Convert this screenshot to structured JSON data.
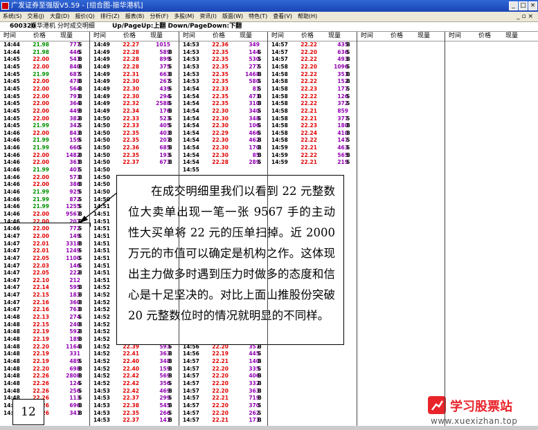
{
  "window": {
    "title": "广发证券至强版V5.59 - [组合图-振华港机]",
    "min": "_",
    "max": "□",
    "close": "×"
  },
  "menu": {
    "items": [
      "系统(S)",
      "交易(J)",
      "大盘(D)",
      "报价(Q)",
      "排行(Z)",
      "报表(B)",
      "分析(F)",
      "多股(M)",
      "资讯(I)",
      "版面(W)",
      "特色(T)",
      "查看(V)",
      "帮助(H)"
    ],
    "right": "_ ▫ ×"
  },
  "info": {
    "code": "600320",
    "name": "振华港机 分时成交明细",
    "hint": "Up/PageUp:上翻 Down/PageDown:下翻"
  },
  "headers": [
    "时间",
    "价格",
    "现量"
  ],
  "trades": {
    "col1": [
      [
        "14:44",
        "21.98",
        "777",
        "S"
      ],
      [
        "14:44",
        "21.98",
        "446",
        "S"
      ],
      [
        "14:45",
        "22.00",
        "541",
        "B"
      ],
      [
        "14:45",
        "22.00",
        "840",
        "B"
      ],
      [
        "14:45",
        "21.99",
        "687",
        "S"
      ],
      [
        "14:45",
        "22.00",
        "478",
        "B"
      ],
      [
        "14:45",
        "22.00",
        "564",
        "B"
      ],
      [
        "14:45",
        "22.00",
        "791",
        "B"
      ],
      [
        "14:45",
        "22.00",
        "364",
        "B"
      ],
      [
        "14:45",
        "22.00",
        "449",
        "B"
      ],
      [
        "14:45",
        "22.00",
        "382",
        "B"
      ],
      [
        "14:45",
        "21.99",
        "342",
        "S"
      ],
      [
        "14:46",
        "22.00",
        "843",
        "B"
      ],
      [
        "14:46",
        "21.99",
        "159",
        "S"
      ],
      [
        "14:46",
        "21.99",
        "660",
        "S"
      ],
      [
        "14:46",
        "22.00",
        "1482",
        "B"
      ],
      [
        "14:46",
        "22.00",
        "361",
        "B"
      ],
      [
        "14:46",
        "21.99",
        "401",
        "S"
      ],
      [
        "14:46",
        "22.00",
        "573",
        "B"
      ],
      [
        "14:46",
        "22.00",
        "386",
        "B"
      ],
      [
        "14:46",
        "21.99",
        "925",
        "S"
      ],
      [
        "14:46",
        "21.99",
        "872",
        "S"
      ],
      [
        "14:46",
        "21.99",
        "1255",
        "S"
      ],
      [
        "14:46",
        "22.00",
        "9567",
        "B"
      ],
      [
        "14:46",
        "22.00",
        "207",
        "B"
      ],
      [
        "14:46",
        "22.00",
        "772",
        "S"
      ],
      [
        "14:47",
        "22.00",
        "149",
        "S"
      ],
      [
        "14:47",
        "22.01",
        "3318",
        "B"
      ],
      [
        "14:47",
        "22.01",
        "1249",
        "S"
      ],
      [
        "14:47",
        "22.05",
        "1100",
        "S"
      ],
      [
        "14:47",
        "22.03",
        "146",
        "S"
      ],
      [
        "14:47",
        "22.05",
        "222",
        "B"
      ],
      [
        "14:47",
        "22.10",
        "212",
        ""
      ],
      [
        "14:47",
        "22.14",
        "595",
        "B"
      ],
      [
        "14:47",
        "22.15",
        "183",
        "B"
      ],
      [
        "14:47",
        "22.16",
        "360",
        "B"
      ],
      [
        "14:47",
        "22.16",
        "763",
        "B"
      ],
      [
        "14:48",
        "22.13",
        "274",
        "S"
      ],
      [
        "14:48",
        "22.15",
        "240",
        "B"
      ],
      [
        "14:48",
        "22.19",
        "592",
        "B"
      ],
      [
        "14:48",
        "22.19",
        "189",
        "B"
      ],
      [
        "14:48",
        "22.20",
        "1164",
        "B"
      ],
      [
        "14:48",
        "22.19",
        "331",
        ""
      ],
      [
        "14:48",
        "22.19",
        "489",
        "S"
      ],
      [
        "14:48",
        "22.20",
        "698",
        "B"
      ],
      [
        "14:48",
        "22.26",
        "2808",
        "B"
      ],
      [
        "14:48",
        "22.26",
        "124",
        "S"
      ],
      [
        "14:48",
        "22.26",
        "256",
        "S"
      ],
      [
        "14:48",
        "22.26",
        "113",
        "S"
      ],
      [
        "14:48",
        "22.26",
        "696",
        "B"
      ],
      [
        "14:48",
        "22.26",
        "341",
        "B"
      ]
    ],
    "col2": [
      [
        "14:49",
        "22.27",
        "1015",
        ""
      ],
      [
        "14:49",
        "22.28",
        "589",
        "B"
      ],
      [
        "14:49",
        "22.28",
        "899",
        "S"
      ],
      [
        "14:49",
        "22.28",
        "375",
        "S"
      ],
      [
        "14:49",
        "22.31",
        "663",
        "B"
      ],
      [
        "14:49",
        "22.30",
        "267",
        "S"
      ],
      [
        "14:49",
        "22.30",
        "439",
        "S"
      ],
      [
        "14:49",
        "22.30",
        "294",
        "S"
      ],
      [
        "14:49",
        "22.32",
        "2588",
        "S"
      ],
      [
        "14:49",
        "22.34",
        "176",
        "B"
      ],
      [
        "14:50",
        "22.33",
        "523",
        "S"
      ],
      [
        "14:50",
        "22.33",
        "405",
        "S"
      ],
      [
        "14:50",
        "22.35",
        "403",
        "B"
      ],
      [
        "14:50",
        "22.35",
        "207",
        "B"
      ],
      [
        "14:50",
        "22.36",
        "685",
        "B"
      ],
      [
        "14:50",
        "22.35",
        "193",
        "S"
      ],
      [
        "14:50",
        "22.37",
        "673",
        "B"
      ],
      [
        "14:50",
        "",
        "",
        ""
      ],
      [
        "14:50",
        "",
        "",
        ""
      ],
      [
        "14:50",
        "",
        "",
        ""
      ],
      [
        "14:50",
        "",
        "",
        ""
      ],
      [
        "14:50",
        "",
        "",
        ""
      ],
      [
        "14:51",
        "",
        "",
        ""
      ],
      [
        "14:51",
        "",
        "",
        ""
      ],
      [
        "14:51",
        "",
        "",
        ""
      ],
      [
        "14:51",
        "",
        "",
        ""
      ],
      [
        "14:51",
        "",
        "",
        ""
      ],
      [
        "14:51",
        "",
        "",
        ""
      ],
      [
        "14:51",
        "",
        "",
        ""
      ],
      [
        "14:51",
        "",
        "",
        ""
      ],
      [
        "14:51",
        "",
        "",
        ""
      ],
      [
        "14:51",
        "",
        "",
        ""
      ],
      [
        "14:51",
        "",
        "",
        ""
      ],
      [
        "14:52",
        "",
        "",
        ""
      ],
      [
        "14:52",
        "",
        "",
        ""
      ],
      [
        "14:52",
        "",
        "",
        ""
      ],
      [
        "14:52",
        "",
        "",
        ""
      ],
      [
        "14:52",
        "",
        "",
        ""
      ],
      [
        "14:52",
        "",
        "",
        ""
      ],
      [
        "14:52",
        "",
        "",
        ""
      ],
      [
        "14:52",
        "",
        "",
        ""
      ],
      [
        "14:52",
        "22.39",
        "593",
        "S"
      ],
      [
        "14:52",
        "22.41",
        "363",
        "B"
      ],
      [
        "14:52",
        "22.40",
        "348",
        "B"
      ],
      [
        "14:52",
        "22.40",
        "159",
        "B"
      ],
      [
        "14:52",
        "22.42",
        "569",
        "B"
      ],
      [
        "14:52",
        "22.42",
        "356",
        "S"
      ],
      [
        "14:53",
        "22.42",
        "469",
        "B"
      ],
      [
        "14:53",
        "22.37",
        "299",
        "S"
      ],
      [
        "14:53",
        "22.38",
        "545",
        "B"
      ],
      [
        "14:53",
        "22.35",
        "266",
        "S"
      ],
      [
        "14:53",
        "22.37",
        "141",
        "B"
      ]
    ],
    "col3": [
      [
        "14:53",
        "22.36",
        "349",
        ""
      ],
      [
        "14:53",
        "22.35",
        "144",
        "S"
      ],
      [
        "14:53",
        "22.35",
        "530",
        "S"
      ],
      [
        "14:53",
        "22.35",
        "277",
        "S"
      ],
      [
        "14:53",
        "22.35",
        "1468",
        "B"
      ],
      [
        "14:53",
        "22.35",
        "580",
        "S"
      ],
      [
        "14:54",
        "22.33",
        "81",
        "S"
      ],
      [
        "14:54",
        "22.35",
        "471",
        "B"
      ],
      [
        "14:54",
        "22.35",
        "310",
        "B"
      ],
      [
        "14:54",
        "22.30",
        "340",
        "S"
      ],
      [
        "14:54",
        "22.30",
        "348",
        "S"
      ],
      [
        "14:54",
        "22.30",
        "106",
        "S"
      ],
      [
        "14:54",
        "22.29",
        "466",
        "S"
      ],
      [
        "14:54",
        "22.30",
        "462",
        "B"
      ],
      [
        "14:54",
        "22.30",
        "170",
        "B"
      ],
      [
        "14:54",
        "22.30",
        "85",
        "B"
      ],
      [
        "14:54",
        "22.28",
        "289",
        "S"
      ],
      [
        "14:55",
        "",
        "",
        ""
      ],
      [
        "14:55",
        "",
        "",
        ""
      ],
      [
        "14:55",
        "",
        "",
        ""
      ],
      [
        "14:55",
        "",
        "",
        ""
      ],
      [
        "14:55",
        "",
        "",
        ""
      ],
      [
        "14:55",
        "",
        "",
        ""
      ],
      [
        "14:55",
        "",
        "",
        ""
      ],
      [
        "14:55",
        "",
        "",
        ""
      ],
      [
        "14:55",
        "",
        "",
        ""
      ],
      [
        "14:55",
        "",
        "",
        ""
      ],
      [
        "14:56",
        "",
        "",
        ""
      ],
      [
        "14:56",
        "",
        "",
        ""
      ],
      [
        "14:56",
        "",
        "",
        ""
      ],
      [
        "14:56",
        "",
        "",
        ""
      ],
      [
        "14:56",
        "",
        "",
        ""
      ],
      [
        "14:56",
        "",
        "",
        ""
      ],
      [
        "14:56",
        "",
        "",
        ""
      ],
      [
        "14:56",
        "",
        "",
        ""
      ],
      [
        "14:56",
        "",
        "",
        ""
      ],
      [
        "14:56",
        "",
        "",
        ""
      ],
      [
        "14:56",
        "",
        "",
        ""
      ],
      [
        "14:56",
        "",
        "",
        ""
      ],
      [
        "14:56",
        "",
        "",
        ""
      ],
      [
        "14:56",
        "",
        "",
        ""
      ],
      [
        "14:56",
        "22.20",
        "357",
        "B"
      ],
      [
        "14:56",
        "22.19",
        "445",
        "S"
      ],
      [
        "14:57",
        "22.21",
        "140",
        "B"
      ],
      [
        "14:57",
        "22.20",
        "335",
        "S"
      ],
      [
        "14:57",
        "22.20",
        "406",
        "B"
      ],
      [
        "14:57",
        "22.20",
        "332",
        "B"
      ],
      [
        "14:57",
        "22.20",
        "363",
        "B"
      ],
      [
        "14:57",
        "22.21",
        "719",
        "B"
      ],
      [
        "14:57",
        "22.20",
        "370",
        "S"
      ],
      [
        "14:57",
        "22.20",
        "262",
        "S"
      ],
      [
        "14:57",
        "22.21",
        "171",
        "B"
      ]
    ],
    "col4": [
      [
        "14:57",
        "22.22",
        "435",
        "B"
      ],
      [
        "14:57",
        "22.20",
        "636",
        "S"
      ],
      [
        "14:57",
        "22.22",
        "493",
        "B"
      ],
      [
        "14:58",
        "22.20",
        "1096",
        "S"
      ],
      [
        "14:58",
        "22.22",
        "351",
        "B"
      ],
      [
        "14:58",
        "22.22",
        "152",
        "B"
      ],
      [
        "14:58",
        "22.23",
        "177",
        "S"
      ],
      [
        "14:58",
        "22.22",
        "126",
        "S"
      ],
      [
        "14:58",
        "22.22",
        "372",
        "S"
      ],
      [
        "14:58",
        "22.21",
        "859",
        ""
      ],
      [
        "14:58",
        "22.21",
        "377",
        "S"
      ],
      [
        "14:58",
        "22.23",
        "180",
        "B"
      ],
      [
        "14:58",
        "22.24",
        "410",
        "B"
      ],
      [
        "14:58",
        "22.22",
        "147",
        "S"
      ],
      [
        "14:59",
        "22.21",
        "463",
        "S"
      ],
      [
        "14:59",
        "22.22",
        "565",
        "B"
      ],
      [
        "14:59",
        "22.21",
        "219",
        "S"
      ]
    ]
  },
  "callout": {
    "text": "在成交明细里我们以看到 22 元整数位大卖单出现一笔一张 9567 手的主动性大买单将 22 元的压单扫掉。近 2000 万元的市值可以确定是机构之作。这体现出主力做多时遇到压力时做多的态度和信心是十足坚决的。对比上面山推股份突破 20 元整数位时的情况就明显的不同样。"
  },
  "page_number": "12",
  "watermark": {
    "brand": "学习股票站",
    "url": "www.xuexizhan.top"
  }
}
